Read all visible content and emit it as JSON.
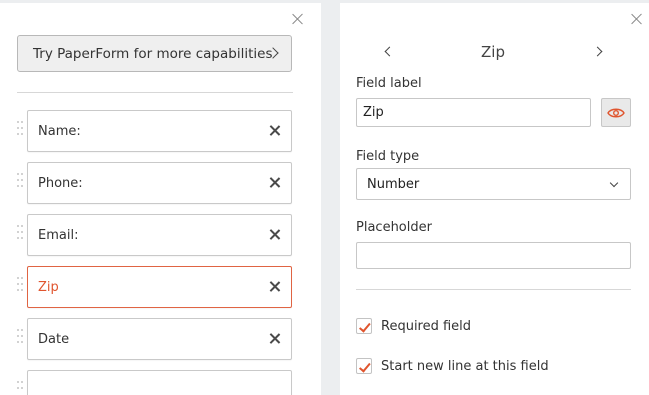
{
  "left_panel": {
    "upgrade_button": "Try PaperForm for more capabilities",
    "fields": [
      {
        "label": "Name:",
        "active": false
      },
      {
        "label": "Phone:",
        "active": false
      },
      {
        "label": "Email:",
        "active": false
      },
      {
        "label": "Zip",
        "active": true
      },
      {
        "label": "Date",
        "active": false
      },
      {
        "label": "",
        "active": false
      }
    ]
  },
  "editor": {
    "title": "Zip",
    "field_label_heading": "Field label",
    "field_label_value": "Zip",
    "field_type_heading": "Field type",
    "field_type_value": "Number",
    "placeholder_heading": "Placeholder",
    "placeholder_value": "",
    "required_label": "Required field",
    "required_checked": true,
    "new_line_label": "Start new line at this field",
    "new_line_checked": true
  },
  "colors": {
    "accent": "#e0552e",
    "background": "#eceef0"
  }
}
